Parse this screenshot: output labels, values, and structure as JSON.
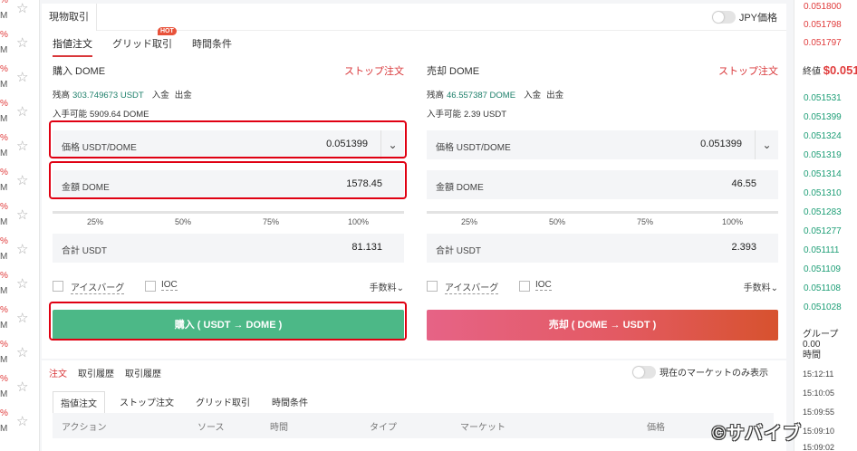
{
  "left_list": [
    {
      "pct": "%",
      "m": "M"
    },
    {
      "pct": "%",
      "m": "M"
    },
    {
      "pct": "%",
      "m": "M"
    },
    {
      "pct": "%",
      "m": "M"
    },
    {
      "pct": "%",
      "m": "M"
    },
    {
      "pct": "%",
      "m": "M"
    },
    {
      "pct": "%",
      "m": "M"
    },
    {
      "pct": "%",
      "m": "M"
    },
    {
      "pct": "%",
      "m": "M"
    },
    {
      "pct": "%",
      "m": "M"
    },
    {
      "pct": "%",
      "m": "M"
    },
    {
      "pct": "%",
      "m": "M"
    },
    {
      "pct": "%",
      "m": "M"
    }
  ],
  "header": {
    "spot_tab": "現物取引",
    "jpy_label": "JPY価格"
  },
  "order_tabs": {
    "limit": "指値注文",
    "grid": "グリッド取引",
    "hot": "HOT",
    "time": "時間条件"
  },
  "buy": {
    "title": "購入 DOME",
    "stop": "ストップ注文",
    "balance_label": "残高",
    "balance_value": "303.749673 USDT",
    "deposit": "入金",
    "withdraw": "出金",
    "avail_label": "入手可能",
    "avail_value": "5909.64 DOME",
    "price_label": "価格 USDT/DOME",
    "price_value": "0.051399",
    "amount_label": "金額 DOME",
    "amount_value": "1578.45",
    "total_label": "合計 USDT",
    "total_value": "81.131",
    "button": "購入 ( USDT → DOME )"
  },
  "sell": {
    "title": "売却 DOME",
    "stop": "ストップ注文",
    "balance_label": "残高",
    "balance_value": "46.557387 DOME",
    "deposit": "入金",
    "withdraw": "出金",
    "avail_label": "入手可能",
    "avail_value": "2.39 USDT",
    "price_label": "価格 USDT/DOME",
    "price_value": "0.051399",
    "amount_label": "金額 DOME",
    "amount_value": "46.55",
    "total_label": "合計 USDT",
    "total_value": "2.393",
    "button": "売却 ( DOME → USDT )"
  },
  "percents": [
    "25%",
    "50%",
    "75%",
    "100%"
  ],
  "options": {
    "iceberg": "アイスバーグ",
    "ioc": "IOC",
    "fee": "手数料⌄"
  },
  "bottom": {
    "tabs": [
      "注文",
      "取引履歴",
      "取引履歴"
    ],
    "market_only": "現在のマーケットのみ表示",
    "sub_tabs": [
      "指値注文",
      "ストップ注文",
      "グリッド取引",
      "時間条件"
    ],
    "columns": [
      "アクション",
      "ソース",
      "時間",
      "タイプ",
      "マーケット",
      "価格"
    ]
  },
  "book": {
    "asks": [
      "0.051800",
      "0.051798",
      "0.051797"
    ],
    "last_label": "終値",
    "last_value": "$0.051",
    "bids": [
      "0.051531",
      "0.051399",
      "0.051324",
      "0.051319",
      "0.051314",
      "0.051310",
      "0.051283",
      "0.051277",
      "0.051111",
      "0.051109",
      "0.051108",
      "0.051028"
    ],
    "group_label": "グループ 0.00",
    "time_label": "時間",
    "times": [
      "15:12:11",
      "15:10:05",
      "15:09:55",
      "15:09:10",
      "15:09:02"
    ]
  },
  "watermark": "©サバイブ",
  "colors": {
    "buy": "#4cb887",
    "sell_gradient_start": "#e66386",
    "sell_gradient_end": "#d7522e",
    "accent": "#d9373a",
    "bid": "#1d9e76",
    "ask": "#e03b3b",
    "highlight": "#e00012"
  }
}
